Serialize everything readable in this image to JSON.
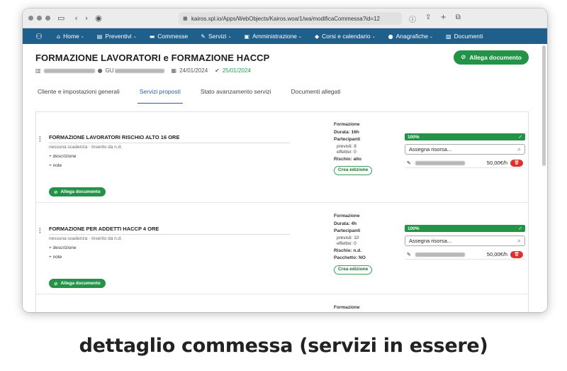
{
  "browser": {
    "url": "kairos.xpl.io/Apps/WebObjects/Kairos.woa/1/wa/modificaCommessa?id=12"
  },
  "nav": {
    "items": [
      {
        "icon": "home-icon",
        "glyph": "⌂",
        "label": "Home",
        "caret": true
      },
      {
        "icon": "document-icon",
        "glyph": "▤",
        "label": "Preventivi",
        "caret": true
      },
      {
        "icon": "folder-icon",
        "glyph": "▬",
        "label": "Commesse",
        "caret": false
      },
      {
        "icon": "wrench-icon",
        "glyph": "✎",
        "label": "Servizi",
        "caret": true
      },
      {
        "icon": "id-card-icon",
        "glyph": "▣",
        "label": "Amministrazione",
        "caret": true
      },
      {
        "icon": "graduation-cap-icon",
        "glyph": "◆",
        "label": "Corsi e calendario",
        "caret": true
      },
      {
        "icon": "users-icon",
        "glyph": "●",
        "label": "Anagrafiche",
        "caret": true
      },
      {
        "icon": "files-icon",
        "glyph": "▧",
        "label": "Documenti",
        "caret": false
      }
    ]
  },
  "page": {
    "title": "FORMAZIONE LAVORATORI e FORMAZIONE HACCP",
    "client_prefix": "GU",
    "date_created": "24/01/2024",
    "date_confirmed": "25/01/2024",
    "attach_label": "Allega documento"
  },
  "tabs": [
    {
      "label": "Cliente e impostazioni generali",
      "active": false
    },
    {
      "label": "Servizi proposti",
      "active": true
    },
    {
      "label": "Stato avanzamento servizi",
      "active": false
    },
    {
      "label": "Documenti allegati",
      "active": false
    }
  ],
  "services": [
    {
      "title": "FORMAZIONE LAVORATORI RISCHIO ALTO 16 ORE",
      "subtitle": "nessuna scadenza  ·  Inserito da n.d.",
      "desc_label": "+ descrizione",
      "note_label": "+ note",
      "attach_label": "Allega documento",
      "type_label": "Formazione",
      "duration": "Durata: 16h",
      "participants_label": "Partecipanti",
      "expected": "previsti: 8",
      "actual": "effettivi: 0",
      "risk": "Rischio: alto",
      "package": "",
      "create_label": "Crea edizione",
      "progress_label": "100%",
      "progress": 1.0,
      "assign_placeholder": "Assegna risorsa...",
      "rate": "50,00€/h"
    },
    {
      "title": "FORMAZIONE PER ADDETTI HACCP 4 ORE",
      "subtitle": "nessuna scadenza  ·  Inserito da n.d.",
      "desc_label": "+ descrizione",
      "note_label": "+ note",
      "attach_label": "Allega documento",
      "type_label": "Formazione",
      "duration": "Durata: 4h",
      "participants_label": "Partecipanti",
      "expected": "previsti: 10",
      "actual": "effettivi: 0",
      "risk": "Rischio: n.d.",
      "package": "Pacchetto: NO",
      "create_label": "Crea edizione",
      "progress_label": "100%",
      "progress": 1.0,
      "assign_placeholder": "Assegna risorsa...",
      "rate": "50,00€/h"
    },
    {
      "type_label": "Formazione"
    }
  ],
  "caption": "dettaglio commessa (servizi in essere)",
  "colors": {
    "navbar": "#1f5f8c",
    "accent_green": "#239447",
    "tab_active": "#2b5bb0",
    "delete_red": "#d9332e"
  }
}
